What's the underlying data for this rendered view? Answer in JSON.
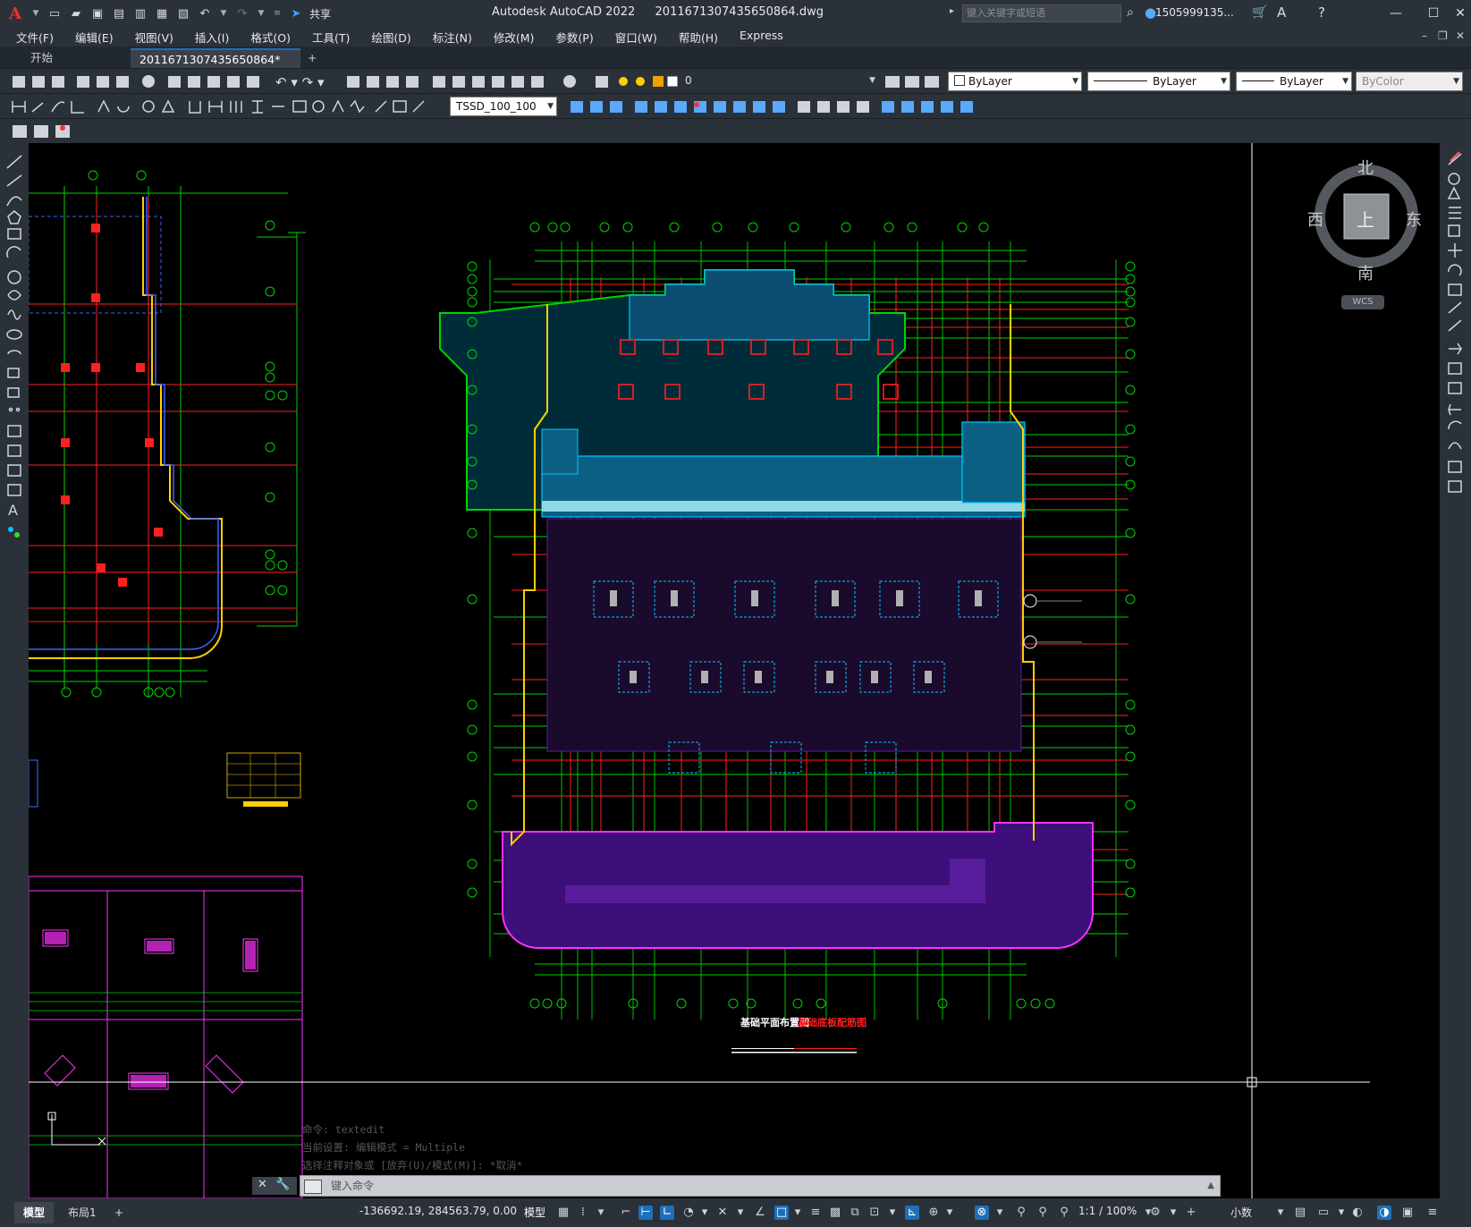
{
  "app": {
    "title": "Autodesk AutoCAD 2022",
    "filename": "2011671307435650864.dwg",
    "logo": "A",
    "share_label": "共享",
    "search_placeholder": "键入关键字或短语",
    "user": "1505999135..."
  },
  "menu": [
    "文件(F)",
    "编辑(E)",
    "视图(V)",
    "插入(I)",
    "格式(O)",
    "工具(T)",
    "绘图(D)",
    "标注(N)",
    "修改(M)",
    "参数(P)",
    "窗口(W)",
    "帮助(H)",
    "Express"
  ],
  "tabs": {
    "start": "开始",
    "active": "2011671307435650864*",
    "add": "+"
  },
  "layers": {
    "current_layer": "0",
    "color": "ByLayer",
    "linetype": "ByLayer",
    "lineweight": "ByLayer",
    "plotstyle": "ByColor",
    "dimstyle": "TSSD_100_100"
  },
  "viewcube": {
    "north": "北",
    "south": "南",
    "east": "东",
    "west": "西",
    "face": "上",
    "wcs": "WCS"
  },
  "drawing": {
    "title_main": "基础平面布置图",
    "title_sub": "基础底板配筋图"
  },
  "command": {
    "history": [
      "命令:  textedit",
      "当前设置: 编辑模式 = Multiple",
      "选择注释对象或 [放弃(U)/模式(M)]: *取消*"
    ],
    "placeholder": "键入命令"
  },
  "status": {
    "model_tab": "模型",
    "layout_tab": "布局1",
    "add_tab": "+",
    "coords": "-136692.19, 284563.79, 0.00",
    "model_label": "模型",
    "scale": "1:1 / 100%",
    "units": "小数"
  },
  "colors": {
    "titlebar": "#2b3139",
    "canvas": "#000000",
    "accent": "#1e6fb8",
    "green": "#00d400",
    "red": "#ff2020",
    "cyan": "#00c8ff",
    "magenta": "#ff30ff",
    "yellow": "#ffff00",
    "purple": "#5a1fa0"
  }
}
